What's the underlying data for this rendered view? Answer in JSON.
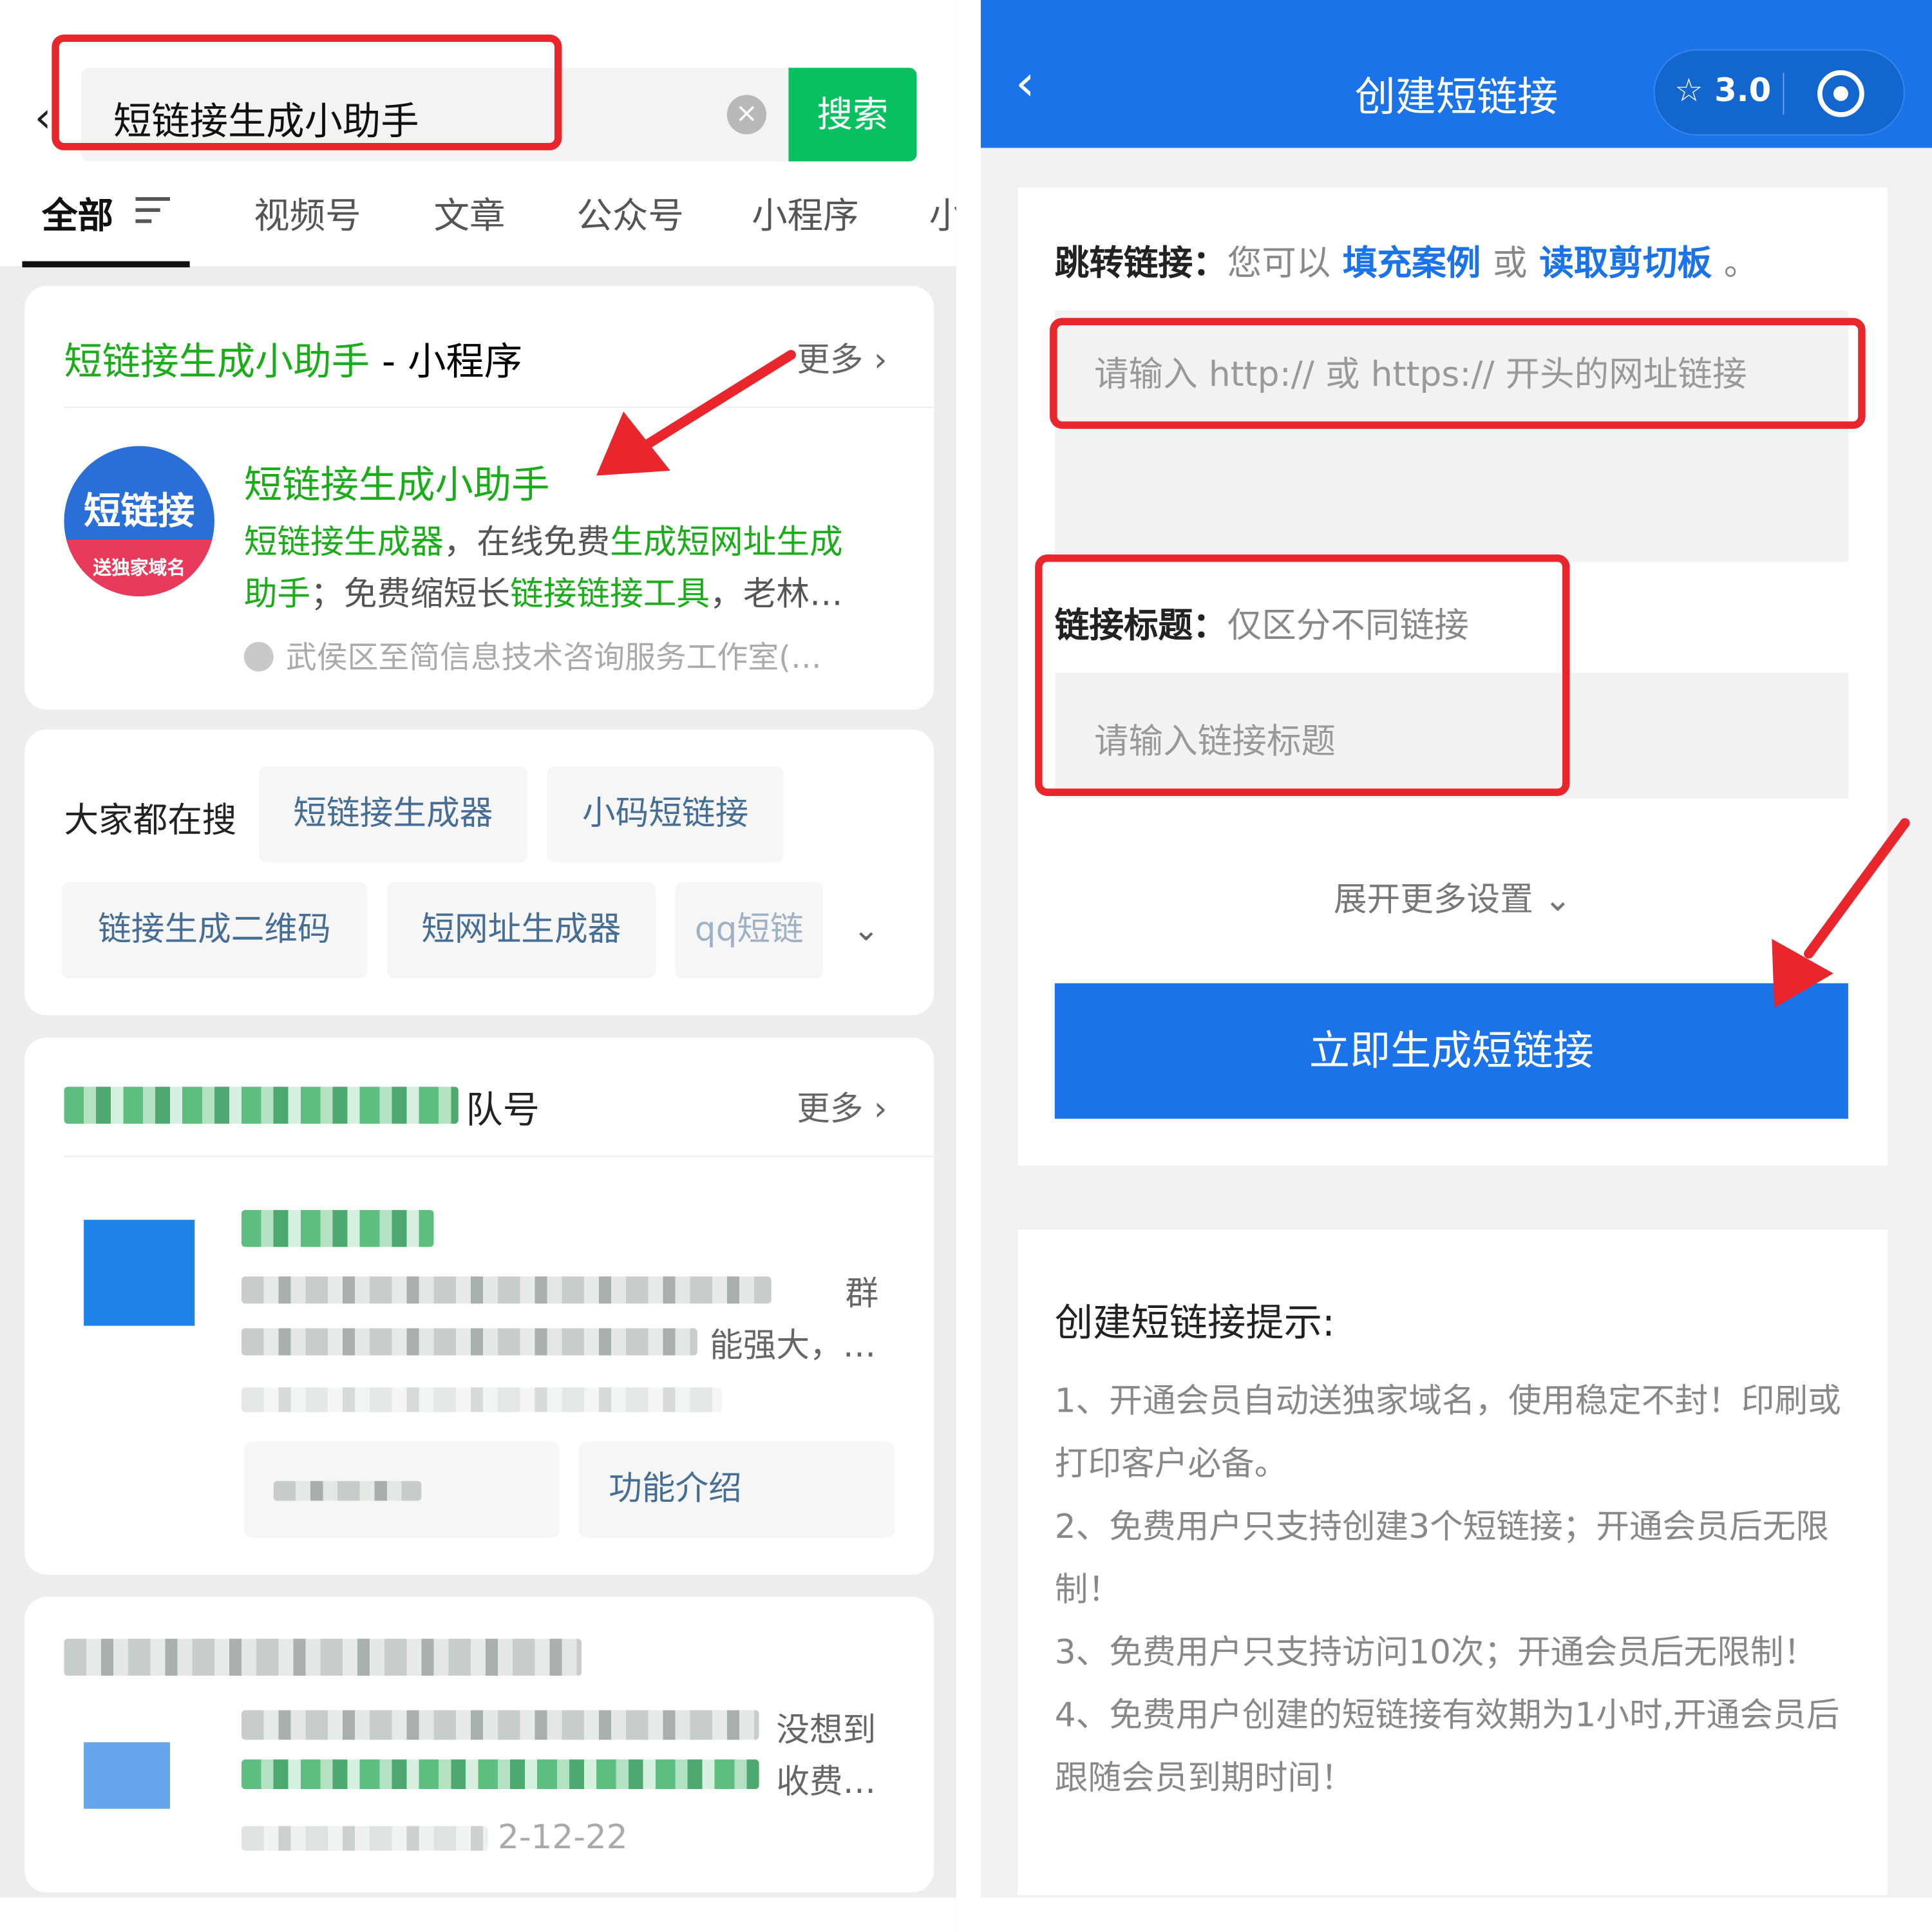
{
  "left": {
    "search": {
      "query": "短链接生成小助手",
      "button": "搜索"
    },
    "tabs": [
      "全部",
      "视频号",
      "文章",
      "公众号",
      "小程序",
      "小"
    ],
    "miniprogram_card": {
      "title_green": "短链接生成小助手",
      "title_suffix": " - 小程序",
      "more": "更多",
      "logo_big": "短链接",
      "logo_small": "送独家域名",
      "name": "短链接生成小助手",
      "desc_1": "短链接生成器",
      "desc_2": "，在线免费",
      "desc_3": "生成短网址生成",
      "desc_4": "助手",
      "desc_5": "；免费缩短长",
      "desc_6": "链接链接工具",
      "desc_7": "，老林…",
      "org": "武侯区至简信息技术咨询服务工作室(…"
    },
    "hot": {
      "label": "大家都在搜",
      "chips": [
        "短链接生成器",
        "小码短链接",
        "链接生成二维码",
        "短网址生成器",
        "qq短链"
      ]
    },
    "account_card": {
      "title_tail": "队号",
      "more": "更多",
      "line1_tail": "群",
      "line2_tail": "能强大，…",
      "button": "功能介绍"
    },
    "article_card": {
      "line1_tail": "没想到",
      "line2_tail": "收费…",
      "date_tail": "2-12-22"
    }
  },
  "right": {
    "header": {
      "title": "创建短链接",
      "score": "3.0"
    },
    "jump": {
      "label": "跳转链接：",
      "hint": "您可以",
      "link1": "填充案例",
      "or": "或",
      "link2": "读取剪切板",
      "end": "。",
      "placeholder": "请输入 http:// 或 https:// 开头的网址链接"
    },
    "title_field": {
      "label": "链接标题：",
      "hint": "仅区分不同链接",
      "placeholder": "请输入链接标题"
    },
    "expand": "展开更多设置",
    "primary_button": "立即生成短链接",
    "tips": {
      "title": "创建短链接提示:",
      "items": [
        "1、开通会员自动送独家域名，使用稳定不封！印刷或打印客户必备。",
        "2、免费用户只支持创建3个短链接；开通会员后无限制！",
        "3、免费用户只支持访问10次；开通会员后无限制！",
        "4、免费用户创建的短链接有效期为1小时,开通会员后跟随会员到期时间！"
      ]
    }
  },
  "colors": {
    "wechat_green": "#07c160",
    "highlight_red": "#e8262b",
    "primary_blue": "#1a73e8"
  }
}
